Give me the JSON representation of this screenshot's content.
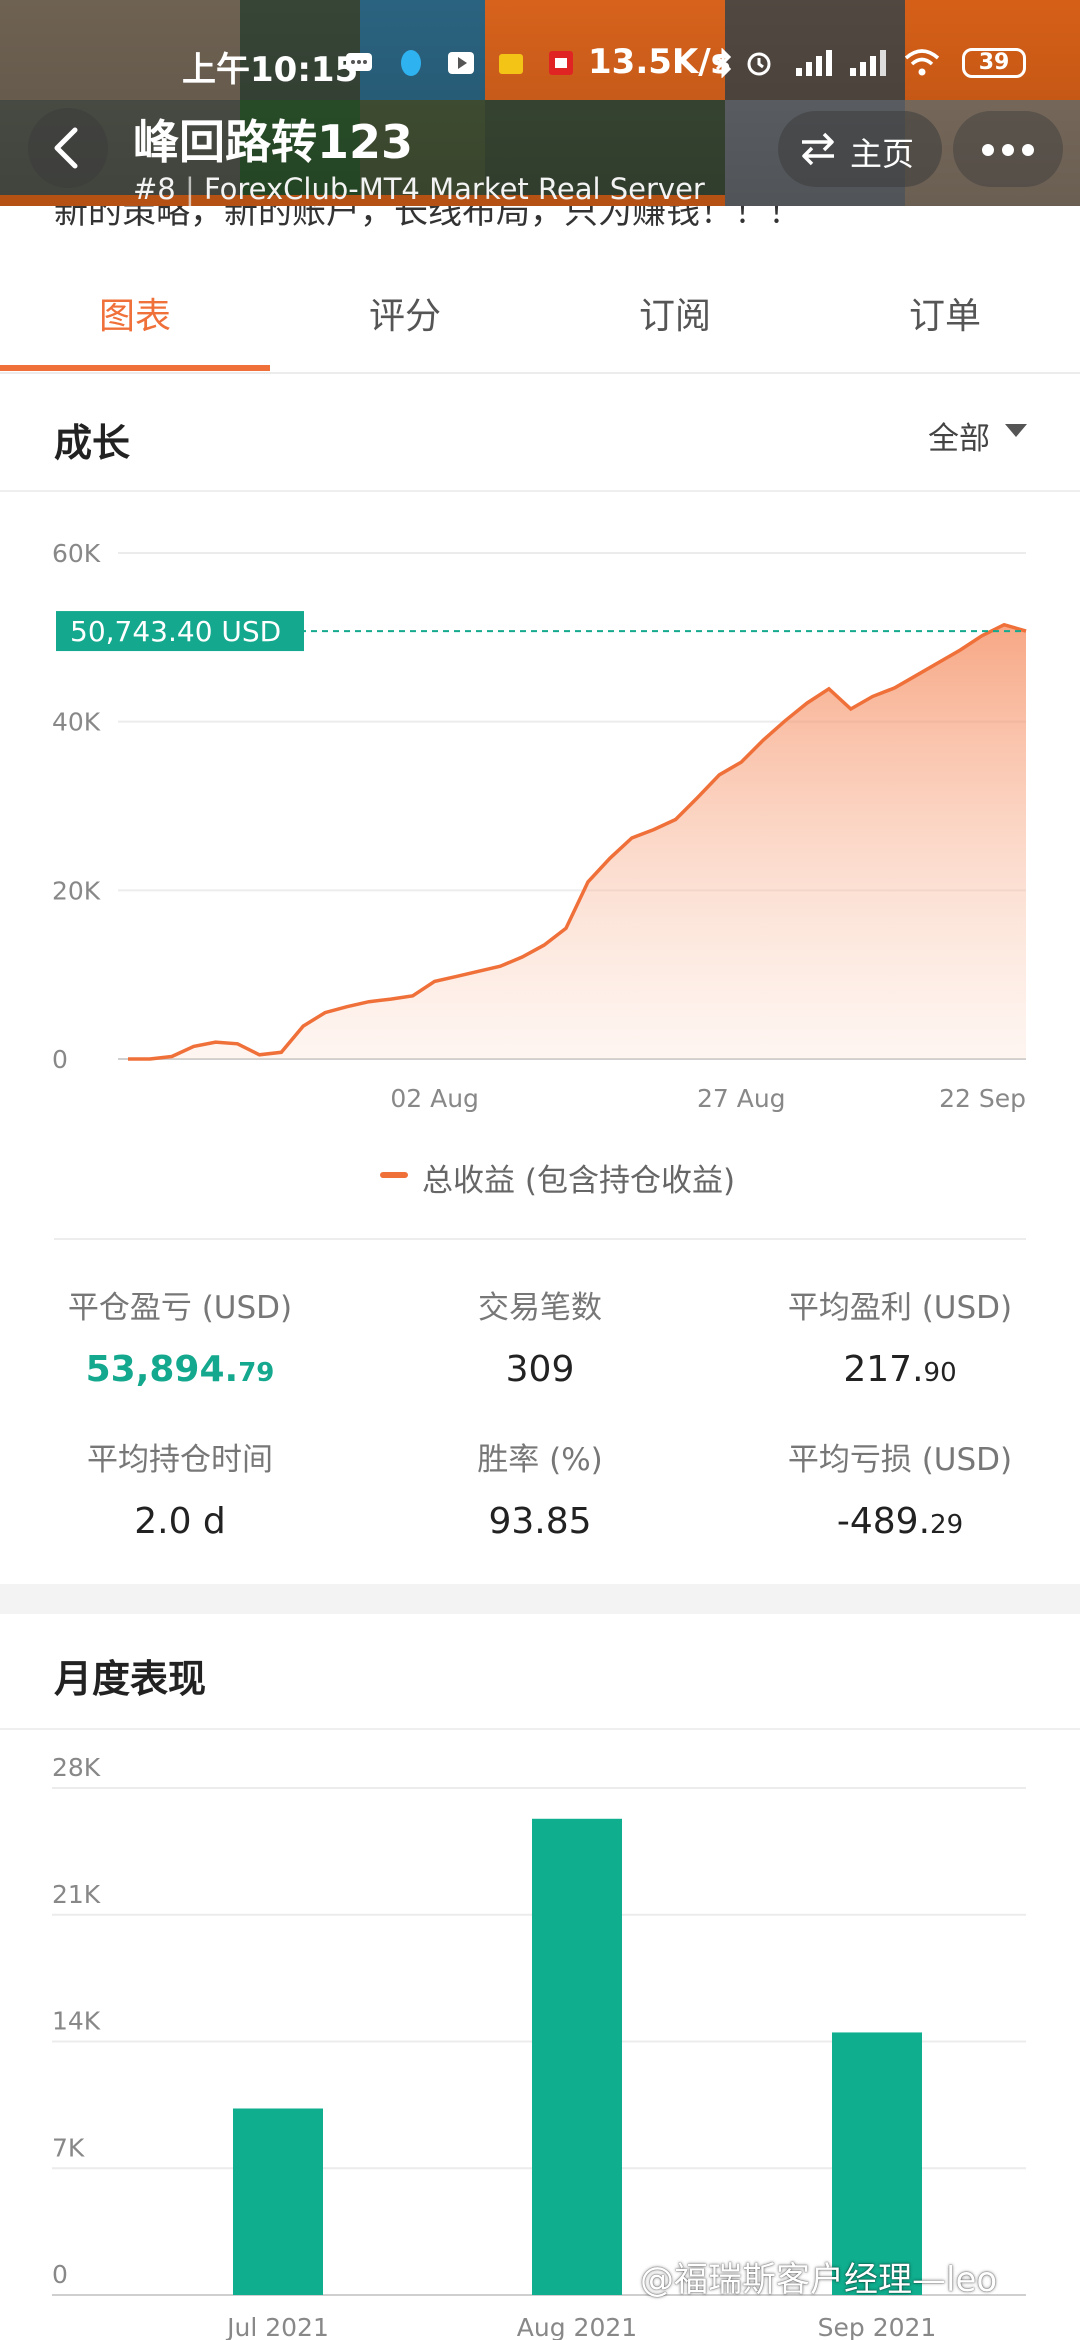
{
  "status_bar": {
    "time": "上午10:15",
    "net_speed": "13.5K/s",
    "battery": "39"
  },
  "header": {
    "trader_name": "峰回路转123",
    "rank": "#8",
    "server": "ForexClub-MT4 Market Real Server",
    "home_label": "主页",
    "peek_text": "新的策略，新的账户，长线布局，只为赚钱！！！"
  },
  "tabs": [
    {
      "label": "图表",
      "active": true
    },
    {
      "label": "评分",
      "active": false
    },
    {
      "label": "订阅",
      "active": false
    },
    {
      "label": "订单",
      "active": false
    }
  ],
  "growth": {
    "title": "成长",
    "range_selector": "全部",
    "current_value_label": "50,743.40 USD",
    "legend": "总收益 (包含持仓收益)"
  },
  "stats": [
    {
      "label": "平仓盈亏 (USD)",
      "value_main": "53,894.",
      "value_small": "79",
      "accent": true
    },
    {
      "label": "交易笔数",
      "value_main": "309",
      "value_small": "",
      "accent": false
    },
    {
      "label": "平均盈利 (USD)",
      "value_main": "217.",
      "value_small": "90",
      "accent": false
    },
    {
      "label": "平均持仓时间",
      "value_main": "2.0 d",
      "value_small": "",
      "accent": false
    },
    {
      "label": "胜率 (%)",
      "value_main": "93.85",
      "value_small": "",
      "accent": false
    },
    {
      "label": "平均亏损 (USD)",
      "value_main": "-489.",
      "value_small": "29",
      "accent": false
    }
  ],
  "monthly": {
    "title": "月度表现"
  },
  "watermark": "@福瑞斯客户经理—leo",
  "colors": {
    "accent_orange": "#f0703a",
    "accent_green": "#14a98e",
    "bar_green": "#0fae8e"
  },
  "chart_data": [
    {
      "type": "area",
      "title": "成长",
      "series": [
        {
          "name": "总收益 (包含持仓收益)",
          "values": [
            0,
            0,
            300,
            1500,
            2000,
            1800,
            500,
            800,
            3900,
            5500,
            6200,
            6800,
            7100,
            7500,
            9200,
            9800,
            10400,
            11000,
            12100,
            13500,
            15500,
            21000,
            23800,
            26200,
            27200,
            28400,
            31000,
            33700,
            35200,
            37800,
            40100,
            42200,
            43900,
            41500,
            43000,
            44000,
            45500,
            47000,
            48500,
            50200,
            51500,
            50743.4
          ]
        }
      ],
      "x_tick_labels": [
        "02 Aug",
        "27 Aug",
        "22 Sep"
      ],
      "x_tick_index": [
        14,
        28,
        41
      ],
      "y_ticks": [
        "0",
        "20K",
        "40K",
        "60K"
      ],
      "ylim": [
        0,
        60000
      ],
      "current_value": 50743.4,
      "grid": true,
      "legend_position": "bottom"
    },
    {
      "type": "bar",
      "title": "月度表现",
      "categories": [
        "Jul 2021",
        "Aug 2021",
        "Sep 2021"
      ],
      "values": [
        10300,
        26300,
        14500
      ],
      "y_ticks": [
        "0",
        "7K",
        "14K",
        "21K",
        "28K"
      ],
      "ylim": [
        0,
        28000
      ],
      "grid": true
    }
  ]
}
